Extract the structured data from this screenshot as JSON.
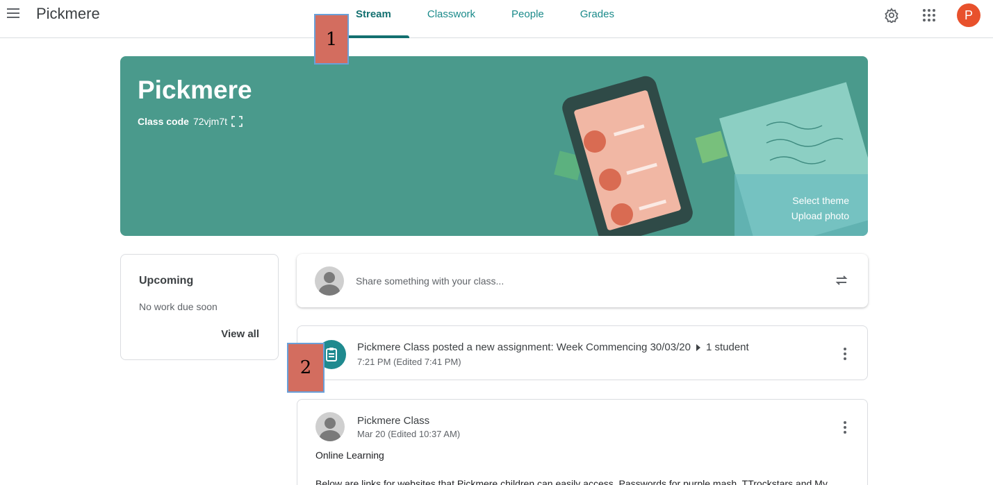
{
  "app": {
    "title": "Pickmere"
  },
  "tabs": [
    {
      "label": "Stream"
    },
    {
      "label": "Classwork"
    },
    {
      "label": "People"
    },
    {
      "label": "Grades"
    }
  ],
  "user": {
    "avatar_letter": "P",
    "avatar_color": "#e8512c"
  },
  "callouts": [
    "1",
    "2"
  ],
  "banner": {
    "title": "Pickmere",
    "class_code_label": "Class code",
    "class_code": "72vjm7t",
    "select_theme": "Select theme",
    "upload_photo": "Upload photo",
    "color": "#4a9a8c"
  },
  "upcoming": {
    "title": "Upcoming",
    "status": "No work due soon",
    "view_all": "View all"
  },
  "share": {
    "placeholder": "Share something with your class..."
  },
  "posts": [
    {
      "title": "Pickmere Class posted a new assignment: Week Commencing 30/03/20",
      "audience": "1 student",
      "meta": "7:21 PM (Edited 7:41 PM)"
    },
    {
      "author": "Pickmere Class",
      "meta": "Mar 20 (Edited 10:37 AM)",
      "heading": "Online Learning",
      "body": "Below are links for websites that Pickmere children can easily access. Passwords for purple mash, TTrockstars and My"
    }
  ],
  "colors": {
    "accent": "#137070",
    "tab": "#1a8a8a"
  }
}
